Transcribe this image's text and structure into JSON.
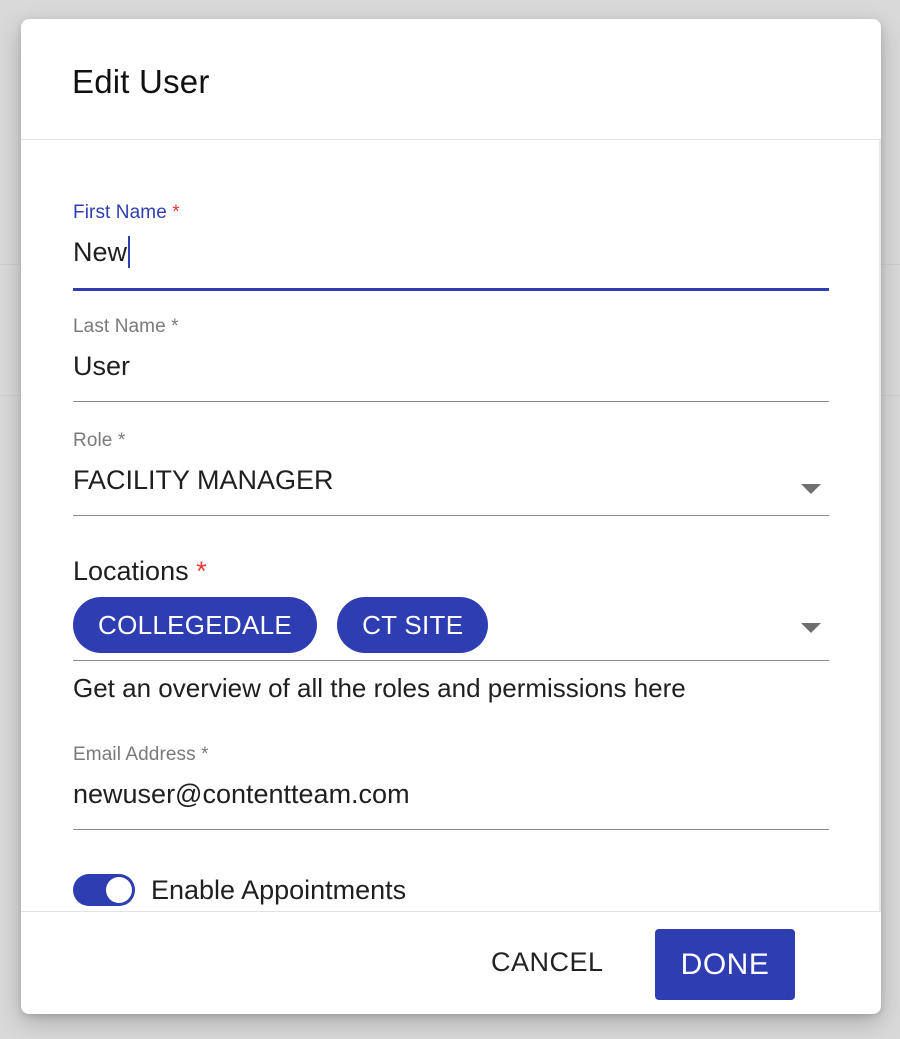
{
  "dialog": {
    "title": "Edit User"
  },
  "fields": {
    "first_name": {
      "label": "First Name",
      "required_mark": "*",
      "value": "New"
    },
    "last_name": {
      "label": "Last Name",
      "required_mark": "*",
      "value": "User"
    },
    "role": {
      "label": "Role",
      "required_mark": "*",
      "value": "FACILITY MANAGER"
    },
    "locations": {
      "label": "Locations",
      "required_mark": "*",
      "chips": [
        "COLLEGEDALE",
        "CT SITE"
      ],
      "help_text": "Get an overview of all the roles and permissions here"
    },
    "email": {
      "label": "Email Address",
      "required_mark": "*",
      "value": "newuser@contentteam.com"
    }
  },
  "toggle": {
    "label": "Enable Appointments",
    "enabled": true
  },
  "footer": {
    "cancel_label": "CANCEL",
    "done_label": "DONE"
  },
  "colors": {
    "accent": "#2f3db3",
    "required_red": "#e53935"
  }
}
